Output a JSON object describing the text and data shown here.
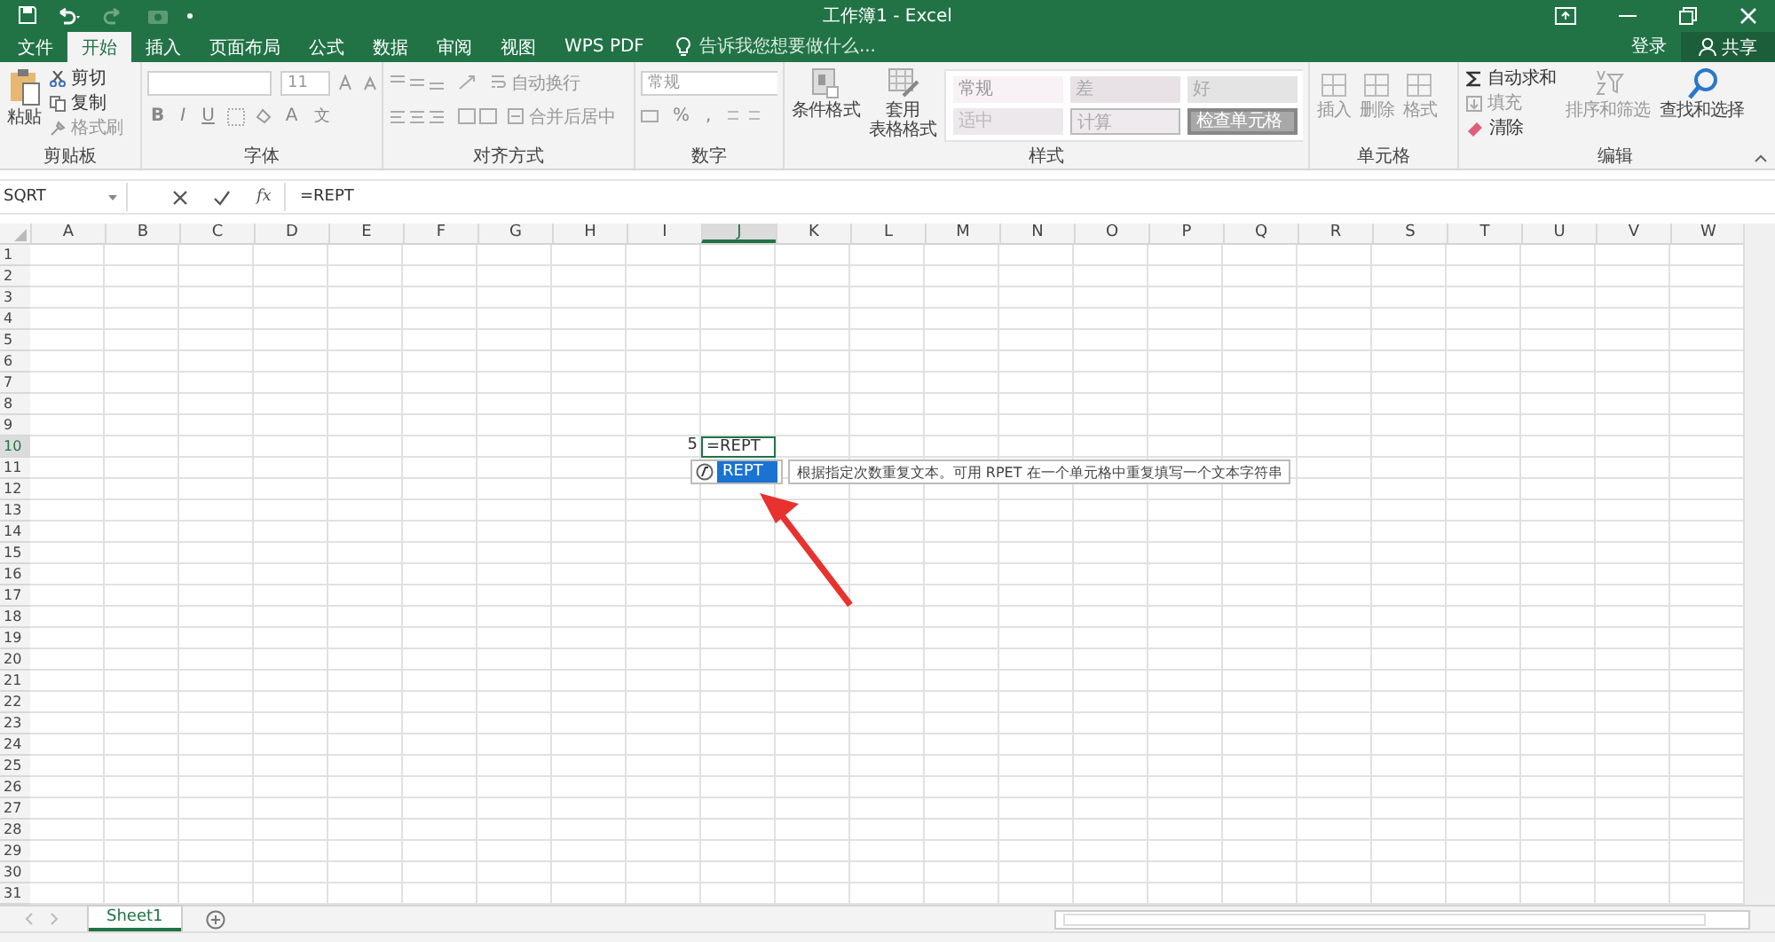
{
  "title_bar": {
    "title": "工作簿1 - Excel"
  },
  "ribbon_tabs": [
    {
      "label": "文件",
      "selected": false
    },
    {
      "label": "开始",
      "selected": true
    },
    {
      "label": "插入",
      "selected": false
    },
    {
      "label": "页面布局",
      "selected": false
    },
    {
      "label": "公式",
      "selected": false
    },
    {
      "label": "数据",
      "selected": false
    },
    {
      "label": "审阅",
      "selected": false
    },
    {
      "label": "视图",
      "selected": false
    },
    {
      "label": "WPS PDF",
      "selected": false
    }
  ],
  "search": {
    "placeholder": "告诉我您想要做什么..."
  },
  "account": {
    "sign_in": "登录",
    "share": "共享"
  },
  "clipboard": {
    "label": "剪贴板",
    "paste": "粘贴",
    "cut": "剪切",
    "copy": "复制",
    "format_painter": "格式刷"
  },
  "font": {
    "label": "字体",
    "size": "11",
    "format_buttons": [
      "B",
      "I",
      "U"
    ],
    "font_color": "A",
    "phonetic": "文"
  },
  "alignment": {
    "label": "对齐方式",
    "wrap": "自动换行",
    "merge": "合并后居中"
  },
  "number": {
    "label": "数字",
    "format": "常规",
    "percent": "%",
    "comma": ","
  },
  "styles": {
    "label": "样式",
    "conditional": "条件格式",
    "table_format": [
      "套用",
      "表格格式"
    ],
    "cell_styles": [
      {
        "label": "常规",
        "kind": "normal"
      },
      {
        "label": "差",
        "kind": "bad"
      },
      {
        "label": "好",
        "kind": "good"
      },
      {
        "label": "适中",
        "kind": "neutral"
      },
      {
        "label": "计算",
        "kind": "calculation"
      },
      {
        "label": "检查单元格",
        "kind": "check"
      }
    ]
  },
  "cells": {
    "label": "单元格",
    "commands": [
      "插入",
      "删除",
      "格式"
    ]
  },
  "editing": {
    "label": "编辑",
    "autosum": "自动求和",
    "fill": "填充",
    "clear": "清除",
    "sort": "排序和筛选",
    "find": "查找和选择"
  },
  "formula_bar": {
    "name_box": "SQRT",
    "fx": "fx",
    "formula": "=REPT"
  },
  "columns": [
    {
      "label": "A",
      "selected": false
    },
    {
      "label": "B",
      "selected": false
    },
    {
      "label": "C",
      "selected": false
    },
    {
      "label": "D",
      "selected": false
    },
    {
      "label": "E",
      "selected": false
    },
    {
      "label": "F",
      "selected": false
    },
    {
      "label": "G",
      "selected": false
    },
    {
      "label": "H",
      "selected": false
    },
    {
      "label": "I",
      "selected": false
    },
    {
      "label": "J",
      "selected": true
    },
    {
      "label": "K",
      "selected": false
    },
    {
      "label": "L",
      "selected": false
    },
    {
      "label": "M",
      "selected": false
    },
    {
      "label": "N",
      "selected": false
    },
    {
      "label": "O",
      "selected": false
    },
    {
      "label": "P",
      "selected": false
    },
    {
      "label": "Q",
      "selected": false
    },
    {
      "label": "R",
      "selected": false
    },
    {
      "label": "S",
      "selected": false
    },
    {
      "label": "T",
      "selected": false
    },
    {
      "label": "U",
      "selected": false
    },
    {
      "label": "V",
      "selected": false
    },
    {
      "label": "W",
      "selected": false
    }
  ],
  "rows": [
    {
      "label": "1",
      "selected": false
    },
    {
      "label": "2",
      "selected": false
    },
    {
      "label": "3",
      "selected": false
    },
    {
      "label": "4",
      "selected": false
    },
    {
      "label": "5",
      "selected": false
    },
    {
      "label": "6",
      "selected": false
    },
    {
      "label": "7",
      "selected": false
    },
    {
      "label": "8",
      "selected": false
    },
    {
      "label": "9",
      "selected": false
    },
    {
      "label": "10",
      "selected": true,
      "cells": {
        "I": {
          "value": "5"
        },
        "J": {
          "value": "=REPT",
          "editing": true
        }
      }
    },
    {
      "label": "11",
      "selected": false
    },
    {
      "label": "12",
      "selected": false
    },
    {
      "label": "13",
      "selected": false
    },
    {
      "label": "14",
      "selected": false
    },
    {
      "label": "15",
      "selected": false
    },
    {
      "label": "16",
      "selected": false
    },
    {
      "label": "17",
      "selected": false
    },
    {
      "label": "18",
      "selected": false
    },
    {
      "label": "19",
      "selected": false
    },
    {
      "label": "20",
      "selected": false
    },
    {
      "label": "21",
      "selected": false
    },
    {
      "label": "22",
      "selected": false
    },
    {
      "label": "23",
      "selected": false
    },
    {
      "label": "24",
      "selected": false
    },
    {
      "label": "25",
      "selected": false
    },
    {
      "label": "26",
      "selected": false
    },
    {
      "label": "27",
      "selected": false
    },
    {
      "label": "28",
      "selected": false
    },
    {
      "label": "29",
      "selected": false
    },
    {
      "label": "30",
      "selected": false
    },
    {
      "label": "31",
      "selected": false
    }
  ],
  "autocomplete": {
    "items": [
      {
        "label": "REPT",
        "selected": true
      }
    ],
    "tooltip": "根据指定次数重复文本。可用 RPET 在一个单元格中重复填写一个文本字符串"
  },
  "sheet_tabs": [
    {
      "label": "Sheet1",
      "selected": true
    }
  ]
}
